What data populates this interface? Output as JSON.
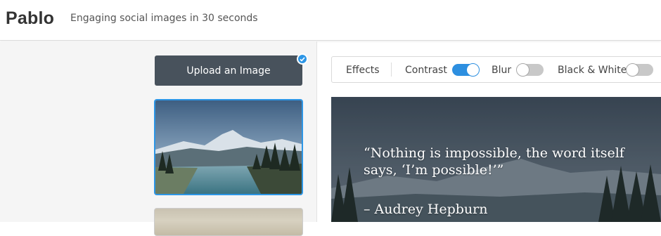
{
  "header": {
    "brand": "Pablo",
    "tagline": "Engaging social images in 30 seconds"
  },
  "sidebar": {
    "upload_label": "Upload an Image",
    "thumbnails": [
      {
        "selected": true
      },
      {
        "selected": false
      }
    ]
  },
  "toolbar": {
    "effects_label": "Effects",
    "contrast_label": "Contrast",
    "contrast_on": true,
    "blur_label": "Blur",
    "blur_on": false,
    "bw_label": "Black & White",
    "bw_on": false
  },
  "canvas": {
    "quote": "“Nothing is impossible, the word itself says, ‘I’m possible!’”",
    "author": "– Audrey Hepburn"
  },
  "colors": {
    "accent": "#2d96e6",
    "upload_button": "#48525c",
    "toggle_off": "#c8c8c8"
  },
  "icons": {
    "selected_badge": "checkmark-icon"
  }
}
